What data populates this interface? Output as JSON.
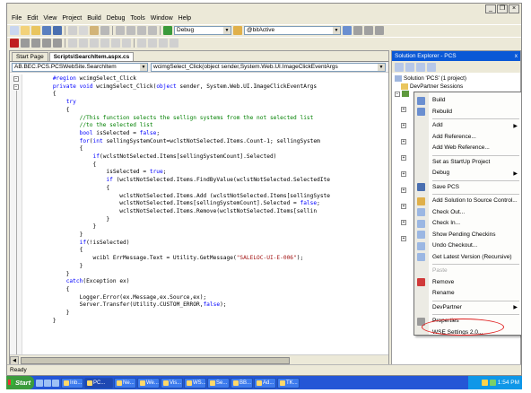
{
  "menu": [
    "File",
    "Edit",
    "View",
    "Project",
    "Build",
    "Debug",
    "Tools",
    "Window",
    "Help"
  ],
  "toolbar": {
    "config_value": "Debug",
    "search_value": "@bitActive"
  },
  "tabs": [
    "Start Page",
    "Scripts\\SearchItem.aspx.cs"
  ],
  "navbar": {
    "class_combo": "AB.BEC.PCS.PCSWebSite.SearchItem",
    "member_combo": "wcimgSelect_Click(object sender,System.Web.UI.ImageClickEventArgs"
  },
  "code_lines": [
    {
      "parts": [
        {
          "t": "        "
        },
        {
          "t": "#region",
          "c": "kw"
        },
        {
          "t": " wcimgSelect_Click"
        }
      ]
    },
    {
      "parts": [
        {
          "t": "        "
        },
        {
          "t": "private",
          "c": "kw"
        },
        {
          "t": " "
        },
        {
          "t": "void",
          "c": "kw"
        },
        {
          "t": " wcimgSelect_Click("
        },
        {
          "t": "object",
          "c": "kw"
        },
        {
          "t": " sender, System.Web.UI.ImageClickEventArgs"
        }
      ]
    },
    {
      "parts": [
        {
          "t": "        {"
        }
      ]
    },
    {
      "parts": [
        {
          "t": "            "
        },
        {
          "t": "try",
          "c": "kw"
        }
      ]
    },
    {
      "parts": [
        {
          "t": "            {"
        }
      ]
    },
    {
      "parts": [
        {
          "t": "                "
        },
        {
          "t": "//This function selects the sellign systems from the not selected list",
          "c": "cm"
        }
      ]
    },
    {
      "parts": [
        {
          "t": "                "
        },
        {
          "t": "//to the selected list",
          "c": "cm"
        }
      ]
    },
    {
      "parts": [
        {
          "t": "                "
        },
        {
          "t": "bool",
          "c": "kw"
        },
        {
          "t": " isSelected = "
        },
        {
          "t": "false",
          "c": "kw"
        },
        {
          "t": ";"
        }
      ]
    },
    {
      "parts": [
        {
          "t": "                "
        },
        {
          "t": "for",
          "c": "kw"
        },
        {
          "t": "("
        },
        {
          "t": "int",
          "c": "kw"
        },
        {
          "t": " sellingSystemCount=wclstNotSelected.Items.Count-1; sellingSystem"
        }
      ]
    },
    {
      "parts": [
        {
          "t": "                {"
        }
      ]
    },
    {
      "parts": [
        {
          "t": "                    "
        },
        {
          "t": "if",
          "c": "kw"
        },
        {
          "t": "(wclstNotSelected.Items[sellingSystemCount].Selected)"
        }
      ]
    },
    {
      "parts": [
        {
          "t": "                    {"
        }
      ]
    },
    {
      "parts": [
        {
          "t": "                        isSelected = "
        },
        {
          "t": "true",
          "c": "kw"
        },
        {
          "t": ";"
        }
      ]
    },
    {
      "parts": [
        {
          "t": "                        "
        },
        {
          "t": "if",
          "c": "kw"
        },
        {
          "t": " (wclstNotSelected.Items.FindByValue(wclstNotSelected.SelectedIte"
        }
      ]
    },
    {
      "parts": [
        {
          "t": "                        {"
        }
      ]
    },
    {
      "parts": [
        {
          "t": "                            wclstNotSelected.Items.Add (wclstNotSelected.Items[sellingSyste"
        }
      ]
    },
    {
      "parts": [
        {
          "t": "                            wclstNotSelected.Items[sellingSystemCount].Selected = "
        },
        {
          "t": "false",
          "c": "kw"
        },
        {
          "t": ";"
        }
      ]
    },
    {
      "parts": [
        {
          "t": "                            wclstNotSelected.Items.Remove(wclstNotSelected.Items[sellin"
        }
      ]
    },
    {
      "parts": [
        {
          "t": "                        }"
        }
      ]
    },
    {
      "parts": [
        {
          "t": "                    }"
        }
      ]
    },
    {
      "parts": [
        {
          "t": "                }"
        }
      ]
    },
    {
      "parts": [
        {
          "t": "                "
        },
        {
          "t": "if",
          "c": "kw"
        },
        {
          "t": "(!isSelected)"
        }
      ]
    },
    {
      "parts": [
        {
          "t": "                {"
        }
      ]
    },
    {
      "parts": [
        {
          "t": "                    wcibl ErrMessage.Text = Utility.GetMessage("
        },
        {
          "t": "\"SALELOC-UI-E-006\"",
          "c": "st"
        },
        {
          "t": ");"
        }
      ]
    },
    {
      "parts": [
        {
          "t": "                }"
        }
      ]
    },
    {
      "parts": [
        {
          "t": "            }"
        }
      ]
    },
    {
      "parts": [
        {
          "t": "            "
        },
        {
          "t": "catch",
          "c": "kw"
        },
        {
          "t": "(Exception ex)"
        }
      ]
    },
    {
      "parts": [
        {
          "t": "            {"
        }
      ]
    },
    {
      "parts": [
        {
          "t": "                Logger.Error(ex.Message,ex.Source,ex);"
        }
      ]
    },
    {
      "parts": [
        {
          "t": "                Server.Transfer(Utility.CUSTOM_ERROR,"
        },
        {
          "t": "false",
          "c": "kw"
        },
        {
          "t": ");"
        }
      ]
    },
    {
      "parts": [
        {
          "t": "            }"
        }
      ]
    },
    {
      "parts": [
        {
          "t": "        }"
        }
      ]
    }
  ],
  "solution_explorer": {
    "title": "Solution Explorer - PCS",
    "close": "x",
    "tree": [
      {
        "label": "Solution 'PCS' (1 project)"
      },
      {
        "label": "DevPartner Sessions"
      }
    ]
  },
  "context_menu": [
    {
      "label": "Build",
      "u": "B",
      "sep_before": false
    },
    {
      "label": "Rebuild",
      "sep_before": false
    },
    {
      "label": "Add",
      "submenu": true,
      "sep_before": true
    },
    {
      "label": "Add Reference...",
      "sep_before": false
    },
    {
      "label": "Add Web Reference...",
      "sep_before": false
    },
    {
      "label": "Set as StartUp Project",
      "sep_before": true
    },
    {
      "label": "Debug",
      "submenu": true,
      "sep_before": false
    },
    {
      "label": "Save PCS",
      "sep_before": true
    },
    {
      "label": "Add Solution to Source Control...",
      "sep_before": true
    },
    {
      "label": "Check Out...",
      "sep_before": false
    },
    {
      "label": "Check In...",
      "sep_before": false
    },
    {
      "label": "Show Pending Checkins",
      "sep_before": false
    },
    {
      "label": "Undo Checkout...",
      "sep_before": false
    },
    {
      "label": "Get Latest Version (Recursive)",
      "sep_before": false
    },
    {
      "label": "Paste",
      "disabled": true,
      "sep_before": true
    },
    {
      "label": "Remove",
      "sep_before": false
    },
    {
      "label": "Rename",
      "sep_before": false
    },
    {
      "label": "DevPartner",
      "submenu": true,
      "sep_before": true
    },
    {
      "label": "Properties",
      "sep_before": true
    },
    {
      "label": "WSE Settings 2.0...",
      "sep_before": false
    }
  ],
  "status": "Ready",
  "taskbar": {
    "start": "Start",
    "tasks": [
      "Inb...",
      "PC...",
      "Ne...",
      "We...",
      "Vis...",
      "WS...",
      "Se...",
      "BB...",
      "Ad...",
      "TK..."
    ],
    "clock": "1:54 PM"
  },
  "colors": {
    "keyword": "#0000ff",
    "comment": "#008000",
    "string": "#a31515",
    "title_blue": "#0a58d6",
    "taskbar": "#2456d6",
    "highlight_ellipse": "#e02020"
  }
}
